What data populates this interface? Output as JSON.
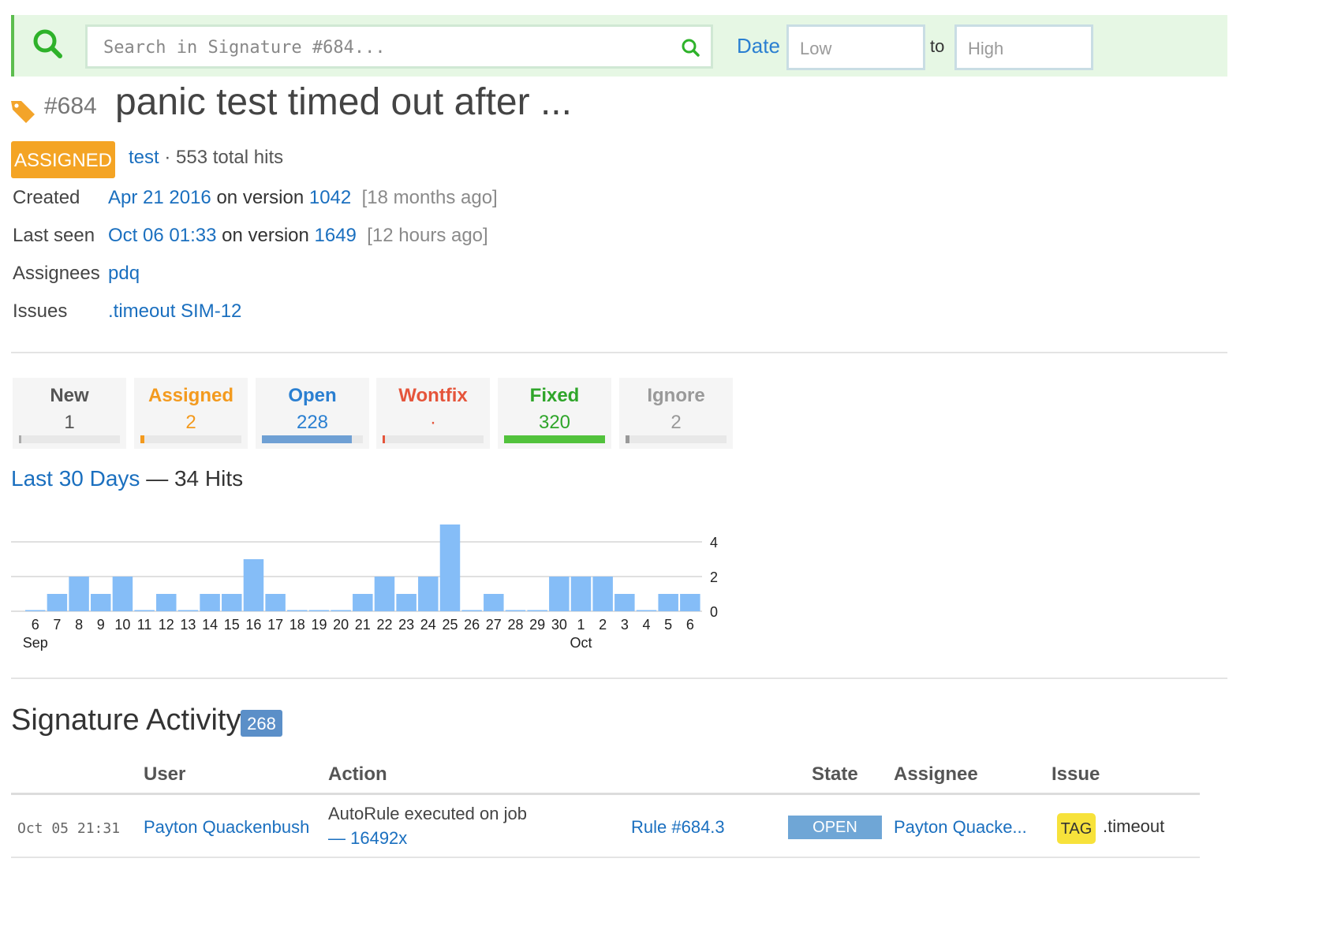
{
  "search": {
    "placeholder": "Search in Signature #684...",
    "date_label": "Date",
    "low_placeholder": "Low",
    "to_label": "to",
    "high_placeholder": "High"
  },
  "signature": {
    "number": "#684",
    "title": "panic test timed out after ...",
    "status": "ASSIGNED",
    "test_link": "test",
    "hits_text": "· 553 total hits"
  },
  "info": {
    "created": {
      "label": "Created",
      "date": "Apr 21 2016",
      "on_version": "on version",
      "version": "1042",
      "ago": "[18 months ago]"
    },
    "last_seen": {
      "label": "Last seen",
      "date": "Oct 06 01:33",
      "on_version": "on version",
      "version": "1649",
      "ago": "[12 hours ago]"
    },
    "assignees": {
      "label": "Assignees",
      "value": "pdq"
    },
    "issues": {
      "label": "Issues",
      "value": ".timeout SIM-12"
    }
  },
  "status_cards": [
    {
      "label": "New",
      "value": "1",
      "color": "#555555",
      "bar_color": "#aaaaaa",
      "fraction": 0.005
    },
    {
      "label": "Assigned",
      "value": "2",
      "color": "#f39a1e",
      "bar_color": "#f39a1e",
      "fraction": 0.03
    },
    {
      "label": "Open",
      "value": "228",
      "color": "#2a7fd1",
      "bar_color": "#6fa0d4",
      "fraction": 0.89
    },
    {
      "label": "Wontfix",
      "value": "·",
      "color": "#e5553b",
      "bar_color": "#e5553b",
      "fraction": 0.01
    },
    {
      "label": "Fixed",
      "value": "320",
      "color": "#2fa52a",
      "bar_color": "#52c23c",
      "fraction": 1.0
    },
    {
      "label": "Ignore",
      "value": "2",
      "color": "#999999",
      "bar_color": "#999999",
      "fraction": 0.03
    }
  ],
  "hits": {
    "link": "Last 30 Days",
    "suffix": "— 34 Hits"
  },
  "chart_data": {
    "type": "bar",
    "categories": [
      "6",
      "7",
      "8",
      "9",
      "10",
      "11",
      "12",
      "13",
      "14",
      "15",
      "16",
      "17",
      "18",
      "19",
      "20",
      "21",
      "22",
      "23",
      "24",
      "25",
      "26",
      "27",
      "28",
      "29",
      "30",
      "1",
      "2",
      "3",
      "4",
      "5",
      "6"
    ],
    "values": [
      0,
      1,
      2,
      1,
      2,
      0,
      1,
      0,
      1,
      1,
      3,
      1,
      0,
      0,
      0,
      1,
      2,
      1,
      2,
      5,
      0,
      1,
      0,
      0,
      2,
      2,
      2,
      1,
      0,
      1,
      1
    ],
    "month_labels": [
      {
        "label": "Sep",
        "index": 0
      },
      {
        "label": "Oct",
        "index": 25
      }
    ],
    "ylim": [
      0,
      5
    ],
    "yticks": [
      0,
      2,
      4
    ],
    "grid": true,
    "bar_color": "#85bdf7",
    "xlabel": "",
    "ylabel": "",
    "title": ""
  },
  "activity": {
    "title": "Signature Activity",
    "count": "268",
    "headers": {
      "user": "User",
      "action": "Action",
      "state": "State",
      "assignee": "Assignee",
      "issue": "Issue"
    },
    "rows": [
      {
        "time": "Oct 05 21:31",
        "user": "Payton Quackenbush",
        "action_text": "AutoRule executed on job",
        "action_link": "— 16492x",
        "rule": "Rule #684.3",
        "state": "OPEN",
        "assignee": "Payton Quacke...",
        "issue_tag": "TAG",
        "issue": ".timeout"
      }
    ]
  },
  "colors": {
    "accent": "#1a6fbf",
    "searchbar_bg": "#e6f7e4",
    "searchbar_border": "#5cbd4e",
    "status_assigned": "#f4a424"
  }
}
